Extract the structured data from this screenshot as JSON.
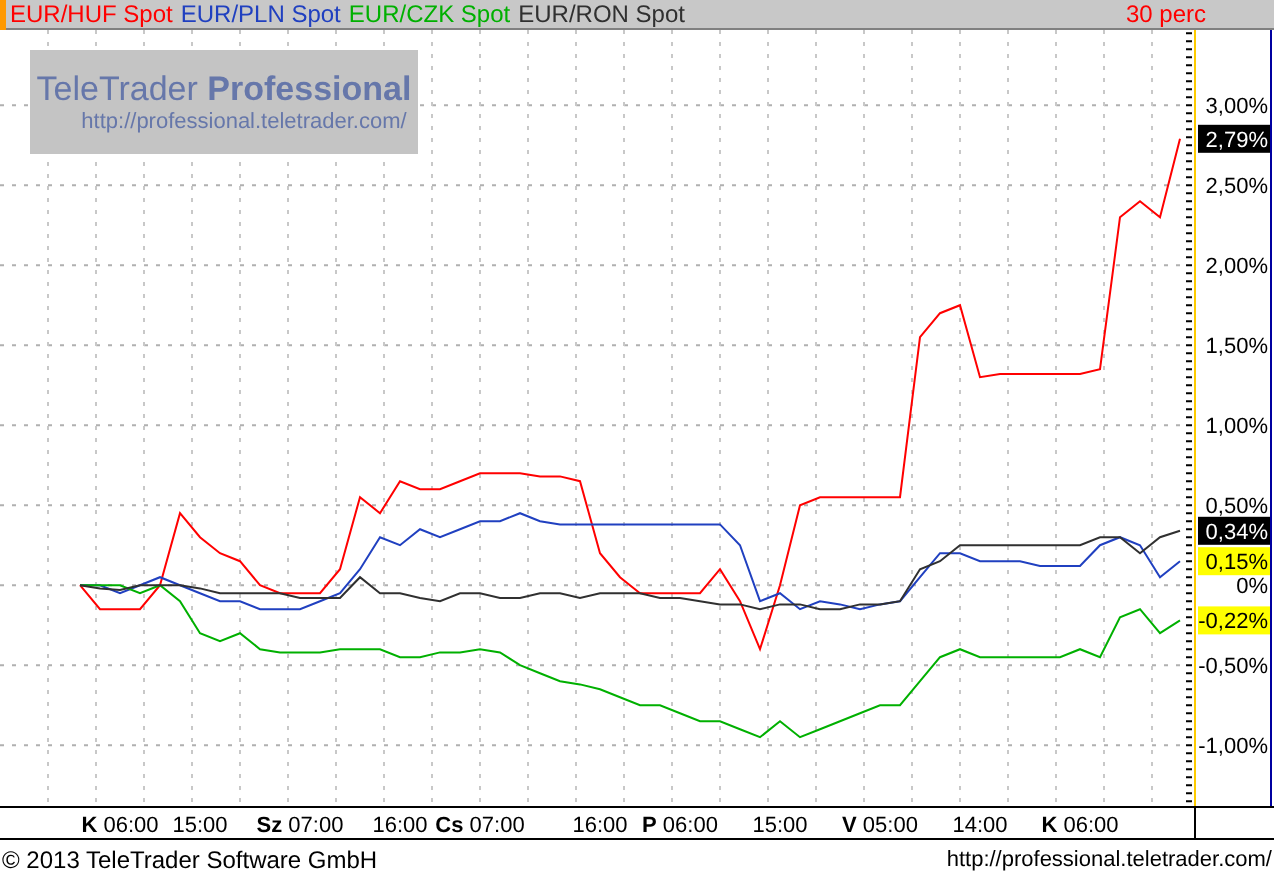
{
  "legend": {
    "period": "30 perc"
  },
  "branding": {
    "title": "TeleTrader",
    "title_bold": "Professional",
    "url": "http://professional.teletrader.com/"
  },
  "chart": {
    "last_values": [
      {
        "text": "2,79%",
        "kind": "dark"
      },
      {
        "text": "0,34%",
        "kind": "dark"
      },
      {
        "text": "0,15%",
        "kind": "light"
      },
      {
        "text": "-0,22%",
        "kind": "light"
      }
    ],
    "chart_data": {
      "type": "line",
      "grid": true,
      "categories": [
        null,
        null,
        "**K** 06:00",
        null,
        null,
        null,
        "15:00",
        null,
        null,
        null,
        null,
        "**Sz** 07:00",
        null,
        null,
        null,
        null,
        "16:00",
        null,
        null,
        null,
        "**Cs** 07:00",
        null,
        null,
        null,
        null,
        null,
        "16:00",
        null,
        null,
        null,
        "**P** 06:00",
        null,
        null,
        null,
        null,
        "15:00",
        null,
        null,
        null,
        null,
        "**V** 05:00",
        null,
        null,
        null,
        null,
        "14:00",
        null,
        null,
        null,
        null,
        "**K** 06:00",
        null,
        null,
        null,
        null,
        null
      ],
      "ylim": [
        -1.38,
        3.47
      ],
      "yticks": [
        {
          "value": 3,
          "label": "3,00%"
        },
        {
          "value": 2.5,
          "label": "2,50%"
        },
        {
          "value": 2,
          "label": "2,00%"
        },
        {
          "value": 1.5,
          "label": "1,50%"
        },
        {
          "value": 1,
          "label": "1,00%"
        },
        {
          "value": 0.5,
          "label": "0,50%"
        },
        {
          "value": 0,
          "label": "0%"
        },
        {
          "value": -0.5,
          "label": "-0,50%"
        },
        {
          "value": -1,
          "label": "-1,00%"
        }
      ],
      "series": [
        {
          "name": "EUR/HUF Spot",
          "color": "#ff0000",
          "values": [
            0,
            -0.15,
            -0.15,
            -0.15,
            0,
            0.45,
            0.3,
            0.2,
            0.15,
            0,
            -0.05,
            -0.05,
            -0.05,
            0.1,
            0.55,
            0.45,
            0.65,
            0.6,
            0.6,
            0.65,
            0.7,
            0.7,
            0.7,
            0.68,
            0.68,
            0.65,
            0.2,
            0.05,
            -0.05,
            -0.05,
            -0.05,
            -0.05,
            0.1,
            -0.1,
            -0.4,
            0,
            0.5,
            0.55,
            0.55,
            0.55,
            0.55,
            0.55,
            1.55,
            1.7,
            1.75,
            1.3,
            1.32,
            1.32,
            1.32,
            1.32,
            1.32,
            1.35,
            2.3,
            2.4,
            2.3,
            2.79
          ]
        },
        {
          "name": "EUR/PLN Spot",
          "color": "#2040c0",
          "values": [
            0,
            0,
            -0.05,
            0,
            0.05,
            0,
            -0.05,
            -0.1,
            -0.1,
            -0.15,
            -0.15,
            -0.15,
            -0.1,
            -0.05,
            0.1,
            0.3,
            0.25,
            0.35,
            0.3,
            0.35,
            0.4,
            0.4,
            0.45,
            0.4,
            0.38,
            0.38,
            0.38,
            0.38,
            0.38,
            0.38,
            0.38,
            0.38,
            0.38,
            0.25,
            -0.1,
            -0.05,
            -0.15,
            -0.1,
            -0.12,
            -0.15,
            -0.12,
            -0.1,
            0.05,
            0.2,
            0.2,
            0.15,
            0.15,
            0.15,
            0.12,
            0.12,
            0.12,
            0.25,
            0.3,
            0.25,
            0.05,
            0.15
          ]
        },
        {
          "name": "EUR/CZK Spot",
          "color": "#00b000",
          "values": [
            0,
            0,
            0,
            -0.05,
            0,
            -0.1,
            -0.3,
            -0.35,
            -0.3,
            -0.4,
            -0.42,
            -0.42,
            -0.42,
            -0.4,
            -0.4,
            -0.4,
            -0.45,
            -0.45,
            -0.42,
            -0.42,
            -0.4,
            -0.42,
            -0.5,
            -0.55,
            -0.6,
            -0.62,
            -0.65,
            -0.7,
            -0.75,
            -0.75,
            -0.8,
            -0.85,
            -0.85,
            -0.9,
            -0.95,
            -0.85,
            -0.95,
            -0.9,
            -0.85,
            -0.8,
            -0.75,
            -0.75,
            -0.6,
            -0.45,
            -0.4,
            -0.45,
            -0.45,
            -0.45,
            -0.45,
            -0.45,
            -0.4,
            -0.45,
            -0.2,
            -0.15,
            -0.3,
            -0.22
          ]
        },
        {
          "name": "EUR/RON Spot",
          "color": "#303030",
          "values": [
            0,
            -0.02,
            -0.03,
            0,
            0,
            0,
            -0.02,
            -0.05,
            -0.05,
            -0.05,
            -0.05,
            -0.08,
            -0.08,
            -0.08,
            0.05,
            -0.05,
            -0.05,
            -0.08,
            -0.1,
            -0.05,
            -0.05,
            -0.08,
            -0.08,
            -0.05,
            -0.05,
            -0.08,
            -0.05,
            -0.05,
            -0.05,
            -0.08,
            -0.08,
            -0.1,
            -0.12,
            -0.12,
            -0.15,
            -0.12,
            -0.12,
            -0.15,
            -0.15,
            -0.12,
            -0.12,
            -0.1,
            0.1,
            0.15,
            0.25,
            0.25,
            0.25,
            0.25,
            0.25,
            0.25,
            0.25,
            0.3,
            0.3,
            0.2,
            0.3,
            0.34
          ]
        }
      ]
    }
  },
  "footer": {
    "copyright": "© 2013 TeleTrader Software GmbH",
    "url": "http://professional.teletrader.com/"
  }
}
